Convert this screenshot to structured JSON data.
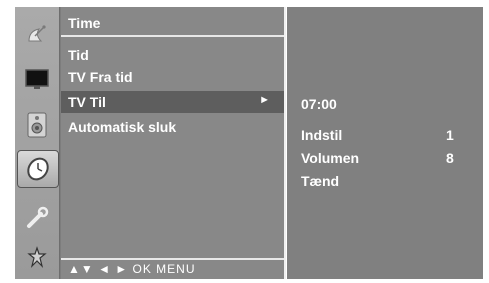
{
  "sidebar": {
    "icons": [
      "satellite-dish-icon",
      "monitor-icon",
      "speaker-icon",
      "clock-icon",
      "wrench-icon",
      "lock-icon"
    ],
    "selected": "clock-icon"
  },
  "menu": {
    "title": "Time",
    "items": [
      {
        "label": "Tid",
        "active": false
      },
      {
        "label": "TV Fra tid",
        "active": false
      },
      {
        "label": "TV Til",
        "active": true,
        "arrow": "►"
      },
      {
        "label": "Automatisk sluk",
        "active": false
      }
    ],
    "footer": "▲▼ ◄ ► OK  MENU"
  },
  "submenu": {
    "time": "07:00",
    "rows": [
      {
        "label": "Indstil",
        "value": "1"
      },
      {
        "label": "Volumen",
        "value": "8"
      },
      {
        "label": "Tænd",
        "value": ""
      }
    ]
  },
  "colors": {
    "panel": "#888888",
    "highlight": "#5e5e5e",
    "text": "#ffffff"
  }
}
